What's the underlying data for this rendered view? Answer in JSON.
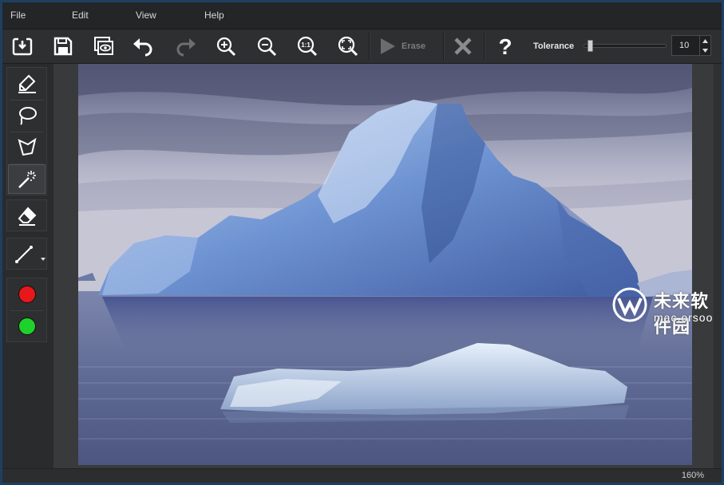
{
  "menu": {
    "file": "File",
    "edit": "Edit",
    "view": "View",
    "help": "Help"
  },
  "toolbar": {
    "icons": [
      "open-icon",
      "save-icon",
      "preview-icon",
      "undo-icon",
      "redo-icon",
      "zoom-in-icon",
      "zoom-out-icon",
      "actual-size-icon",
      "fit-to-window-icon"
    ],
    "actual_size_label": "1:1",
    "erase_label": "Erase",
    "cancel_icon": "close-icon",
    "help_icon": "question-icon",
    "help_glyph": "?",
    "tolerance_label": "Tolerance",
    "tolerance_value": "10",
    "tolerance_level_percent": 5
  },
  "tools": {
    "selection": [
      "marker-icon",
      "lasso-icon",
      "polygon-lasso-icon",
      "magic-wand-icon"
    ],
    "active_tool": "magic-wand-icon",
    "eraser": "eraser-icon",
    "line": "line-tool-icon",
    "colors": [
      {
        "name": "red",
        "hex": "#e8171b"
      },
      {
        "name": "green",
        "hex": "#1fd12b"
      }
    ]
  },
  "canvas": {
    "image_subject": "iceberg-photo"
  },
  "watermark": {
    "name": "未来软件园",
    "url": "mac.orsoon.com"
  },
  "status": {
    "zoom": "160%"
  },
  "colors": {
    "window_bg": "#2a2b2d",
    "frame": "#1f3f62",
    "panel": "#2e2f31"
  }
}
